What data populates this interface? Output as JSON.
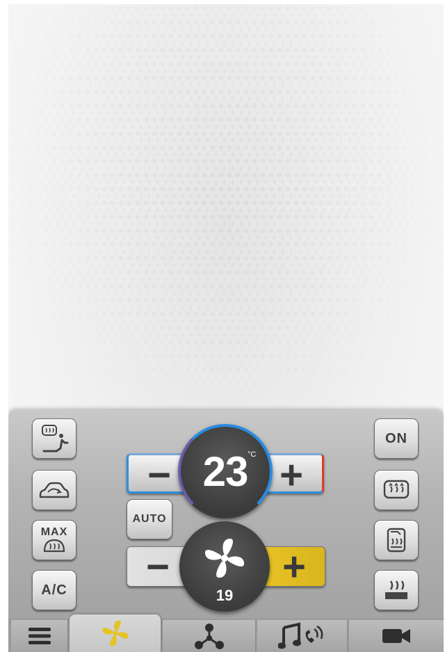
{
  "climate": {
    "temperature": {
      "value": "23",
      "unit": "°C",
      "decrease_symbol": "−",
      "increase_symbol": "+"
    },
    "fan": {
      "speed": "19",
      "decrease_symbol": "−",
      "increase_symbol": "+"
    },
    "left_buttons": {
      "rear_defrost_seat": "rear-defrost-seat-icon",
      "recirculation": "air-recirculation-icon",
      "max_top": "MAX",
      "max_defrost": "max-defrost-icon",
      "ac": "A/C"
    },
    "auto_label": "AUTO",
    "right_buttons": {
      "power": "ON",
      "rear_defrost": "rear-window-defrost-icon",
      "seat_heat": "seat-heat-icon",
      "floor_heat": "floor-heat-icon"
    },
    "colors": {
      "cold_accent": "#2f8fe0",
      "hot_accent": "#e03a2a",
      "fan_active": "#e5c324",
      "dial_bg": "#3c3c3c"
    }
  },
  "tabs": [
    {
      "icon": "menu-icon"
    },
    {
      "icon": "fan-icon",
      "active": true
    },
    {
      "icon": "hub-icon"
    },
    {
      "icon": "music-phone-icon"
    },
    {
      "icon": "video-camera-icon"
    }
  ]
}
